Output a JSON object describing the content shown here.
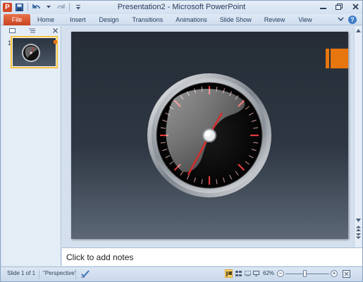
{
  "window": {
    "title": "Presentation2 - Microsoft PowerPoint",
    "app_icon_letter": "P"
  },
  "quick_access": {
    "icons": [
      "save-icon",
      "undo-icon",
      "redo-icon",
      "customize-icon"
    ]
  },
  "ribbon": {
    "file_label": "File",
    "tabs": [
      "Home",
      "Insert",
      "Design",
      "Transitions",
      "Animations",
      "Slide Show",
      "Review",
      "View"
    ]
  },
  "slide_pane": {
    "slide_number": "1"
  },
  "notes": {
    "placeholder": "Click to add notes"
  },
  "status": {
    "slide_info": "Slide 1 of 1",
    "theme": "\"Perspective\"",
    "zoom_level": "62%",
    "zoom_fraction": 0.45
  },
  "colors": {
    "accent_orange": "#e8760f",
    "file_tab": "#d2522b",
    "slide_bg": "#2b333e",
    "needle_red": "#d42b2b"
  }
}
